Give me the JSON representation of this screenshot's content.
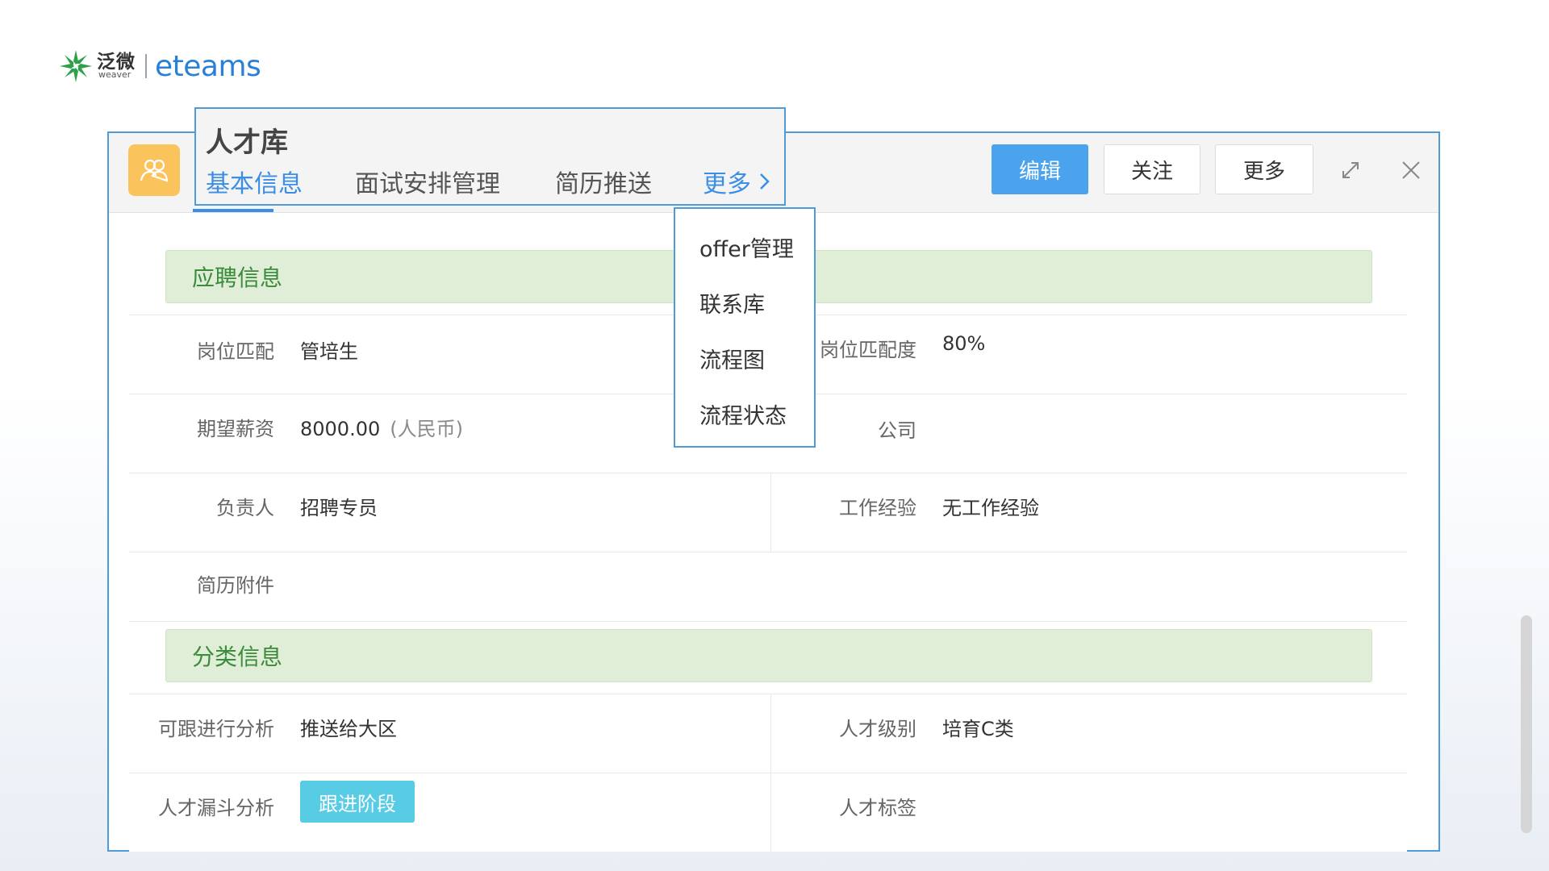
{
  "logo": {
    "cn_text": "泛微",
    "sub_text": "weaver",
    "product": "eteams"
  },
  "header": {
    "edit_label": "编辑",
    "follow_label": "关注",
    "more_label": "更多"
  },
  "tabs_popup": {
    "title": "人才库",
    "tabs": [
      "基本信息",
      "面试安排管理",
      "简历推送"
    ],
    "more_label": "更多"
  },
  "dropdown": {
    "items": [
      "offer管理",
      "联系库",
      "流程图",
      "流程状态"
    ]
  },
  "sections": {
    "application": {
      "title": "应聘信息",
      "position_match_label": "岗位匹配",
      "position_match_value": "管培生",
      "match_degree_label": "岗位匹配度",
      "match_degree_value": "80%",
      "salary_label": "期望薪资",
      "salary_value": "8000.00",
      "salary_currency": "(人民币)",
      "company_label": "公司",
      "owner_label": "负责人",
      "owner_value": "招聘专员",
      "experience_label": "工作经验",
      "experience_value": "无工作经验",
      "resume_label": "简历附件"
    },
    "classification": {
      "title": "分类信息",
      "followable_label": "可跟进行分析",
      "followable_value": "推送给大区",
      "level_label": "人才级别",
      "level_value": "培育C类",
      "funnel_label": "人才漏斗分析",
      "funnel_tag": "跟进阶段",
      "tags_label": "人才标签"
    }
  },
  "colors": {
    "accent_blue": "#4aa3ec",
    "border_blue": "#4e9bd8",
    "section_green_bg": "#e0eed8",
    "section_green_text": "#3a8b3a",
    "tag_cyan": "#58cce4",
    "avatar_orange": "#fbc35c"
  }
}
